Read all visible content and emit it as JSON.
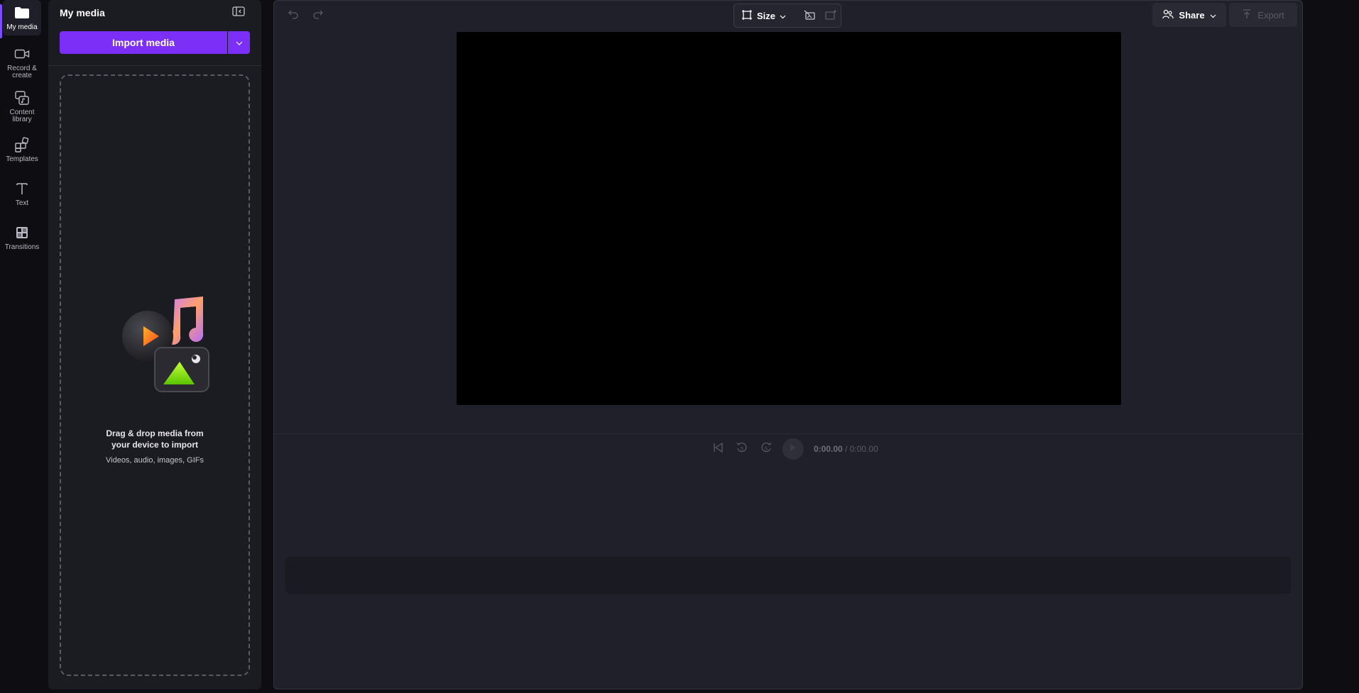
{
  "rail": {
    "items": [
      {
        "label": "My media",
        "icon": "folder-icon"
      },
      {
        "label": "Record & create",
        "icon": "video-camera-icon"
      },
      {
        "label": "Content library",
        "icon": "library-icon"
      },
      {
        "label": "Templates",
        "icon": "templates-icon"
      },
      {
        "label": "Text",
        "icon": "text-icon"
      },
      {
        "label": "Transitions",
        "icon": "transitions-icon"
      }
    ]
  },
  "panel": {
    "title": "My media",
    "import_label": "Import media",
    "drop_title_line1": "Drag & drop media from",
    "drop_title_line2": "your device to import",
    "drop_sub": "Videos, audio, images, GIFs"
  },
  "toolbar": {
    "size_label": "Size",
    "share_label": "Share",
    "export_label": "Export"
  },
  "playback": {
    "current_time": "0:00.00",
    "total_time": "/ 0:00.00",
    "skip_seconds": "5"
  },
  "colors": {
    "accent": "#7b2ff7",
    "background": "#20202a",
    "preview": "#000000"
  }
}
